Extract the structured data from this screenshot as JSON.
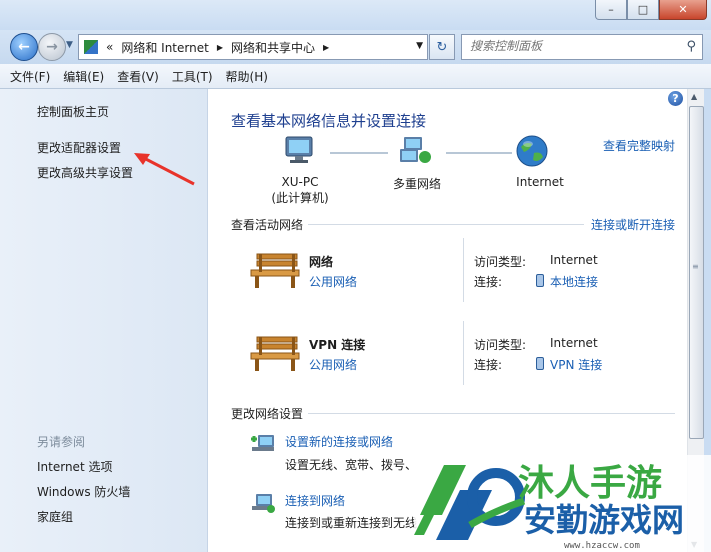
{
  "address_bar": {
    "prefix": "«",
    "crumbs": [
      "网络和 Internet",
      "网络和共享中心"
    ],
    "refresh_icon": "refresh-icon",
    "search_placeholder": "搜索控制面板"
  },
  "menu": [
    "文件(F)",
    "编辑(E)",
    "查看(V)",
    "工具(T)",
    "帮助(H)"
  ],
  "sidebar": {
    "links": [
      "控制面板主页",
      "更改适配器设置",
      "更改高级共享设置"
    ],
    "see_also_title": "另请参阅",
    "see_also": [
      "Internet 选项",
      "Windows 防火墙",
      "家庭组"
    ],
    "arrow_color": "#e8332a"
  },
  "main": {
    "heading": "查看基本网络信息并设置连接",
    "full_map_link": "查看完整映射",
    "map": {
      "pc_name": "XU-PC",
      "pc_sub": "(此计算机)",
      "multi_net": "多重网络",
      "internet": "Internet"
    },
    "active_title": "查看活动网络",
    "connect_link": "连接或断开连接",
    "networks": [
      {
        "name": "网络",
        "category": "公用网络",
        "access_label": "访问类型:",
        "access_value": "Internet",
        "conn_label": "连接:",
        "conn_value": "本地连接"
      },
      {
        "name": "VPN 连接",
        "category": "公用网络",
        "access_label": "访问类型:",
        "access_value": "Internet",
        "conn_label": "连接:",
        "conn_value": "VPN 连接"
      }
    ],
    "change_title": "更改网络设置",
    "tasks": [
      {
        "link": "设置新的连接或网络",
        "desc": "设置无线、宽带、拨号、"
      },
      {
        "link": "连接到网络",
        "desc": "连接到或重新连接到无线"
      }
    ]
  },
  "watermark": {
    "top_text": "沐人手游",
    "bottom_text": "安勤游戏网",
    "url": "www.hzaccw.com"
  },
  "colors": {
    "link": "#1a5fb4",
    "heading": "#1e3f8f",
    "watermark_green": "#3aa843",
    "watermark_blue": "#1b5fa8"
  }
}
